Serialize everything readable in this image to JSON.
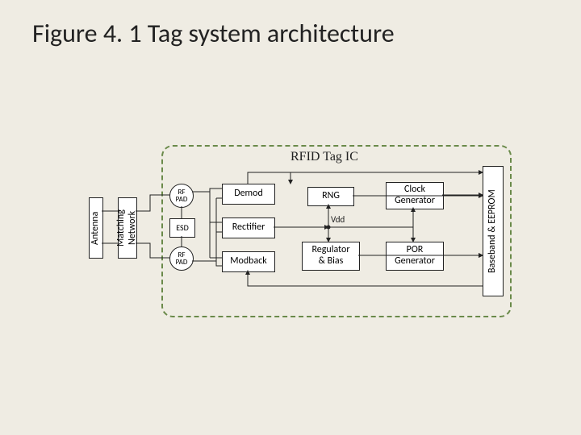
{
  "title": "Figure 4. 1 Tag system architecture",
  "ic_label": "RFID Tag IC",
  "blocks": {
    "antenna": "Antenna",
    "matching": "Matching\nNetwork",
    "esd": "ESD",
    "rfpad1": "RF\nPAD",
    "rfpad2": "RF\nPAD",
    "demod": "Demod",
    "rectifier": "Rectifier",
    "modback": "Modback",
    "rng": "RNG",
    "regbias": "Regulator\n& Bias",
    "clock": "Clock\nGenerator",
    "por": "POR\nGenerator",
    "baseband": "Baseband & EEPROM",
    "vdd": "Vdd"
  }
}
